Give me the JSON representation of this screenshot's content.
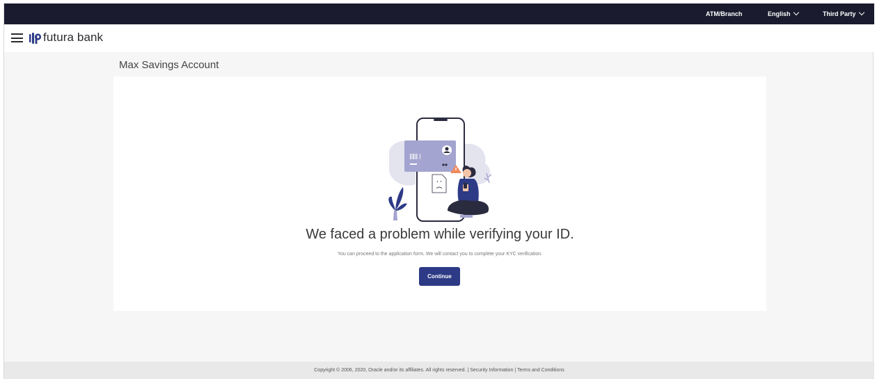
{
  "topbar": {
    "atm_branch": "ATM/Branch",
    "language": "English",
    "user_type": "Third Party"
  },
  "header": {
    "brand": "futura bank"
  },
  "page": {
    "title": "Max Savings Account"
  },
  "message": {
    "heading": "We faced a problem while verifying your ID.",
    "subtext": "You can proceed to the application form. We will contact you to complete your KYC verification.",
    "button_label": "Continue"
  },
  "footer": {
    "text": "Copyright © 2006, 2020, Oracle and/or its affiliates. All rights reserved. | Security Information | Terms and Conditions"
  },
  "colors": {
    "topbar_bg": "#1a1b2e",
    "primary_button": "#2d3a86",
    "illustration_purple": "#a3a4cf",
    "warning_orange": "#f08a5d"
  }
}
